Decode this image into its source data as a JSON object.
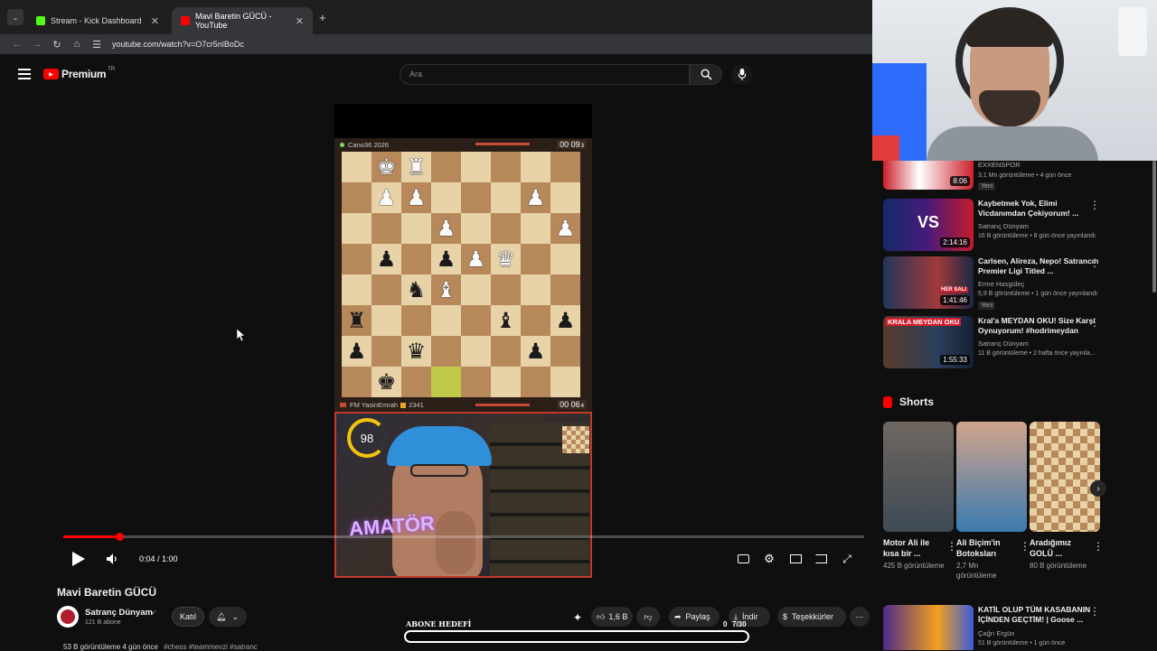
{
  "browser": {
    "tabs": [
      {
        "title": "Stream - Kick Dashboard",
        "favicon_color": "#53fc18"
      },
      {
        "title": "Mavi Baretin GÜCÜ - YouTube",
        "favicon_color": "#ff0000"
      }
    ],
    "url": "youtube.com/watch?v=O7cr5nlBoDc"
  },
  "header": {
    "logo_text": "Premium",
    "region": "TR",
    "search_placeholder": "Ara"
  },
  "board": {
    "top_player": "Cano36 2026",
    "top_clock": "00 09",
    "top_clock_tenths": "3",
    "bottom_player": "FM YasinEmrah",
    "bottom_rating": "2341",
    "bottom_clock": "00 06",
    "bottom_clock_tenths": "4",
    "gauge_value": "98",
    "pieces": [
      {
        "sq": "b8",
        "glyph": "♚",
        "side": "w"
      },
      {
        "sq": "c8",
        "glyph": "♜",
        "side": "w"
      },
      {
        "sq": "b7",
        "glyph": "♟",
        "side": "w"
      },
      {
        "sq": "c7",
        "glyph": "♟",
        "side": "w"
      },
      {
        "sq": "g7",
        "glyph": "♟",
        "side": "w"
      },
      {
        "sq": "d6",
        "glyph": "♟",
        "side": "w"
      },
      {
        "sq": "h6",
        "glyph": "♟",
        "side": "w"
      },
      {
        "sq": "b5",
        "glyph": "♟",
        "side": "b"
      },
      {
        "sq": "d5",
        "glyph": "♟",
        "side": "b"
      },
      {
        "sq": "e5",
        "glyph": "♟",
        "side": "w"
      },
      {
        "sq": "f5",
        "glyph": "♛",
        "side": "w"
      },
      {
        "sq": "c4",
        "glyph": "♞",
        "side": "b"
      },
      {
        "sq": "d4",
        "glyph": "♝",
        "side": "w"
      },
      {
        "sq": "a3",
        "glyph": "♜",
        "side": "b"
      },
      {
        "sq": "f3",
        "glyph": "♝",
        "side": "b"
      },
      {
        "sq": "h3",
        "glyph": "♟",
        "side": "b"
      },
      {
        "sq": "a2",
        "glyph": "♟",
        "side": "b"
      },
      {
        "sq": "c2",
        "glyph": "♛",
        "side": "b"
      },
      {
        "sq": "g2",
        "glyph": "♟",
        "side": "b"
      },
      {
        "sq": "b1",
        "glyph": "♚",
        "side": "b"
      }
    ],
    "highlight": "d1"
  },
  "player": {
    "time": "0:04 / 1:00",
    "progress": 0.07
  },
  "video": {
    "title": "Mavi Baretin GÜCÜ",
    "channel": "Satranç Dünyam",
    "subscribers": "121 B abone",
    "join_label": "Katıl",
    "likes": "1,6 B",
    "share_label": "Paylaş",
    "download_label": "İndir",
    "thanks_label": "Teşekkürler",
    "meta": "53 B görüntüleme  4 gün önce",
    "hashtags": "#chess #teammevzi #satranc"
  },
  "overlay": {
    "goal_label": "ABONE HEDEFİ",
    "goal_count": "0",
    "goal_target": "7/30"
  },
  "sidebar": {
    "recs": [
      {
        "title": "",
        "channel": "EXXENSPOR",
        "meta": "3,1 Mn görüntüleme • 4 gün önce",
        "badge": "Yeni",
        "duration": "8:06"
      },
      {
        "title": "Kaybetmek Yok, Elimi Vicdanımdan Çekiyorum! ...",
        "channel": "Satranç Dünyam",
        "meta": "16 B görüntüleme • 8 gün önce yayınlandı",
        "badge": "",
        "duration": "2:14:16"
      },
      {
        "title": "Carlsen, Alireza, Nepo! Satrancın Premier Ligi Titled ...",
        "channel": "Emre Hasgüleç",
        "meta": "5,9 B görüntüleme • 1 gün önce yayınlandı",
        "badge": "Yeni",
        "duration": "1:41:46"
      },
      {
        "title": "Kral'a MEYDAN OKU! Size Karşı Oynuyorum! #hodrimeydan",
        "channel": "Satranç Dünyam",
        "meta": "11 B görüntüleme • 2 hafta önce yayınla...",
        "badge": "",
        "duration": "1:55:33"
      },
      {
        "title": "KATİL OLUP TÜM KASABANIN İÇİNDEN GEÇTİM! | Goose ...",
        "channel": "Çağrı Ergün",
        "meta": "51 B görüntüleme • 1 gün önce",
        "badge": "",
        "duration": ""
      }
    ],
    "thumb_captions": [
      "KRALA MEYDAN OKU",
      "HER SALI"
    ],
    "shorts_title": "Shorts",
    "shorts": [
      {
        "title": "Motor Ali ile kısa bir ...",
        "views": "425 B görüntüleme"
      },
      {
        "title": "Ali Biçim'in Botoksları",
        "views": "2,7 Mn görüntüleme"
      },
      {
        "title": "Aradığımız GOLÜ ...",
        "views": "80 B görüntüleme"
      }
    ]
  }
}
